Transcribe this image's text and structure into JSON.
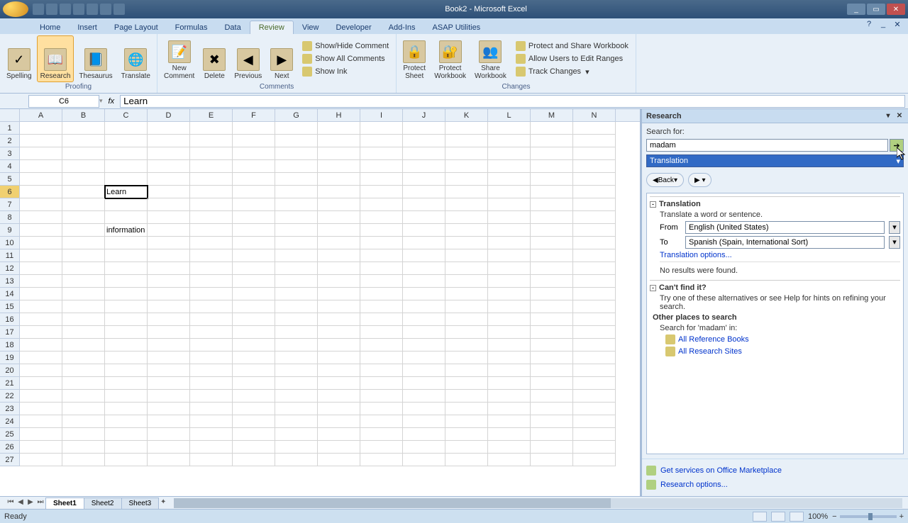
{
  "app": {
    "title": "Book2 - Microsoft Excel"
  },
  "tabs": [
    "Home",
    "Insert",
    "Page Layout",
    "Formulas",
    "Data",
    "Review",
    "View",
    "Developer",
    "Add-Ins",
    "ASAP Utilities"
  ],
  "active_tab": 5,
  "ribbon": {
    "proofing": {
      "label": "Proofing",
      "spelling": "Spelling",
      "research": "Research",
      "thesaurus": "Thesaurus",
      "translate": "Translate"
    },
    "comments": {
      "label": "Comments",
      "new": "New\nComment",
      "delete": "Delete",
      "previous": "Previous",
      "next": "Next",
      "showhide": "Show/Hide Comment",
      "showall": "Show All Comments",
      "showink": "Show Ink"
    },
    "changes": {
      "label": "Changes",
      "psheet": "Protect\nSheet",
      "pwb": "Protect\nWorkbook",
      "share": "Share\nWorkbook",
      "protshare": "Protect and Share Workbook",
      "allow": "Allow Users to Edit Ranges",
      "track": "Track Changes"
    }
  },
  "fbar": {
    "name": "C6",
    "fx": "fx",
    "formula": "Learn"
  },
  "columns": [
    "A",
    "B",
    "C",
    "D",
    "E",
    "F",
    "G",
    "H",
    "I",
    "J",
    "K",
    "L",
    "M",
    "N"
  ],
  "rows": 27,
  "active": {
    "r": 6,
    "c": "C"
  },
  "cells": {
    "C6": "Learn",
    "C9": "information"
  },
  "sheets": [
    "Sheet1",
    "Sheet2",
    "Sheet3"
  ],
  "active_sheet": 0,
  "research": {
    "title": "Research",
    "search_label": "Search for:",
    "search_value": "madam",
    "service": "Translation",
    "back": "Back",
    "sec_translation": "Translation",
    "trans_hint": "Translate a word or sentence.",
    "from_lbl": "From",
    "from_val": "English (United States)",
    "to_lbl": "To",
    "to_val": "Spanish (Spain, International Sort)",
    "options": "Translation options...",
    "noresults": "No results were found.",
    "cantfind": "Can't find it?",
    "try": "Try one of these alternatives or see Help for hints on refining your search.",
    "otherplaces": "Other places to search",
    "searchin": "Search for 'madam' in:",
    "allref": "All Reference Books",
    "allres": "All Research Sites",
    "getservices": "Get services on Office Marketplace",
    "resoptions": "Research options..."
  },
  "status": {
    "ready": "Ready",
    "zoom": "100%"
  }
}
